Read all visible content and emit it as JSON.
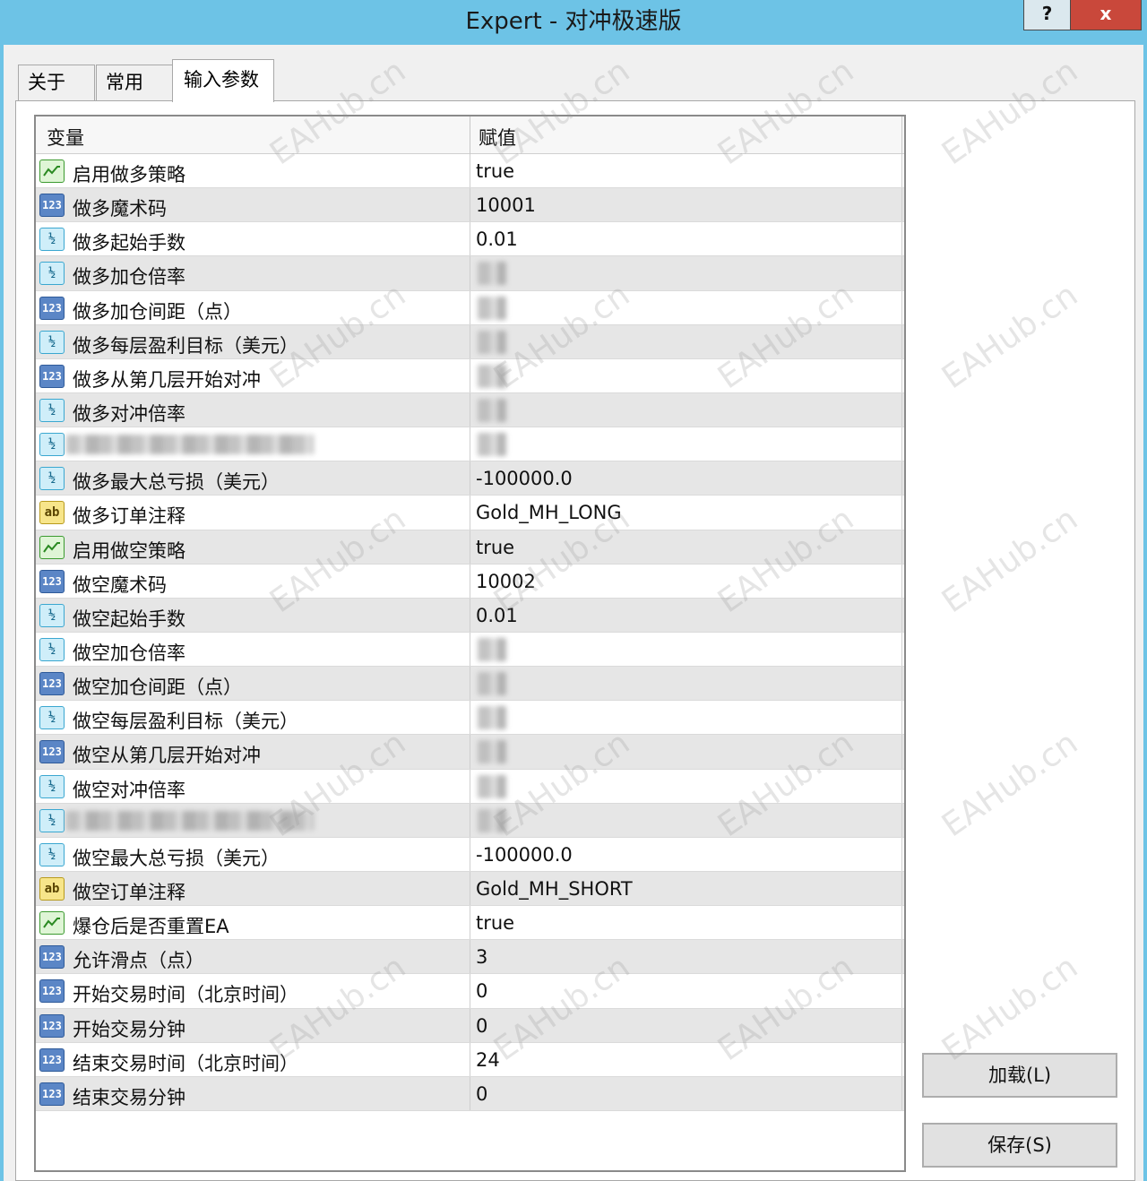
{
  "window": {
    "title": "Expert - 对冲极速版",
    "help_label": "?",
    "close_label": "x"
  },
  "tabs": [
    {
      "label": "关于"
    },
    {
      "label": "常用"
    },
    {
      "label": "输入参数"
    }
  ],
  "grid": {
    "columns": {
      "variable": "变量",
      "value": "赋值"
    },
    "rows": [
      {
        "type": "bool",
        "name": "启用做多策略",
        "value": "true"
      },
      {
        "type": "int",
        "name": "做多魔术码",
        "value": "10001"
      },
      {
        "type": "double",
        "name": "做多起始手数",
        "value": "0.01"
      },
      {
        "type": "double",
        "name": "做多加仓倍率",
        "value": ""
      },
      {
        "type": "int",
        "name": "做多加仓间距（点）",
        "value": ""
      },
      {
        "type": "double",
        "name": "做多每层盈利目标（美元）",
        "value": ""
      },
      {
        "type": "int",
        "name": "做多从第几层开始对冲",
        "value": ""
      },
      {
        "type": "double",
        "name": "做多对冲倍率",
        "value": ""
      },
      {
        "type": "double",
        "name": "",
        "value": ""
      },
      {
        "type": "double",
        "name": "做多最大总亏损（美元）",
        "value": "-100000.0"
      },
      {
        "type": "string",
        "name": "做多订单注释",
        "value": "Gold_MH_LONG"
      },
      {
        "type": "bool",
        "name": "启用做空策略",
        "value": "true"
      },
      {
        "type": "int",
        "name": "做空魔术码",
        "value": "10002"
      },
      {
        "type": "double",
        "name": "做空起始手数",
        "value": "0.01"
      },
      {
        "type": "double",
        "name": "做空加仓倍率",
        "value": ""
      },
      {
        "type": "int",
        "name": "做空加仓间距（点）",
        "value": ""
      },
      {
        "type": "double",
        "name": "做空每层盈利目标（美元）",
        "value": ""
      },
      {
        "type": "int",
        "name": "做空从第几层开始对冲",
        "value": ""
      },
      {
        "type": "double",
        "name": "做空对冲倍率",
        "value": ""
      },
      {
        "type": "double",
        "name": "",
        "value": ""
      },
      {
        "type": "double",
        "name": "做空最大总亏损（美元）",
        "value": "-100000.0"
      },
      {
        "type": "string",
        "name": "做空订单注释",
        "value": "Gold_MH_SHORT"
      },
      {
        "type": "bool",
        "name": "爆仓后是否重置EA",
        "value": "true"
      },
      {
        "type": "int",
        "name": "允许滑点（点）",
        "value": "3"
      },
      {
        "type": "int",
        "name": "开始交易时间（北京时间）",
        "value": "0"
      },
      {
        "type": "int",
        "name": "开始交易分钟",
        "value": "0"
      },
      {
        "type": "int",
        "name": "结束交易时间（北京时间）",
        "value": "24"
      },
      {
        "type": "int",
        "name": "结束交易分钟",
        "value": "0"
      }
    ]
  },
  "icons": {
    "int": "123",
    "double": "½",
    "string": "ab",
    "bool": "bool-icon"
  },
  "buttons": {
    "load": "加载(L)",
    "save": "保存(S)"
  },
  "watermark": "EAHub.cn",
  "colors": {
    "titlebar": "#6dc3e6",
    "close": "#c9483b",
    "int_icon": "#5b86c6",
    "double_icon": "#cfeef9",
    "bool_icon": "#dff5d6",
    "string_icon": "#f7e58a"
  }
}
